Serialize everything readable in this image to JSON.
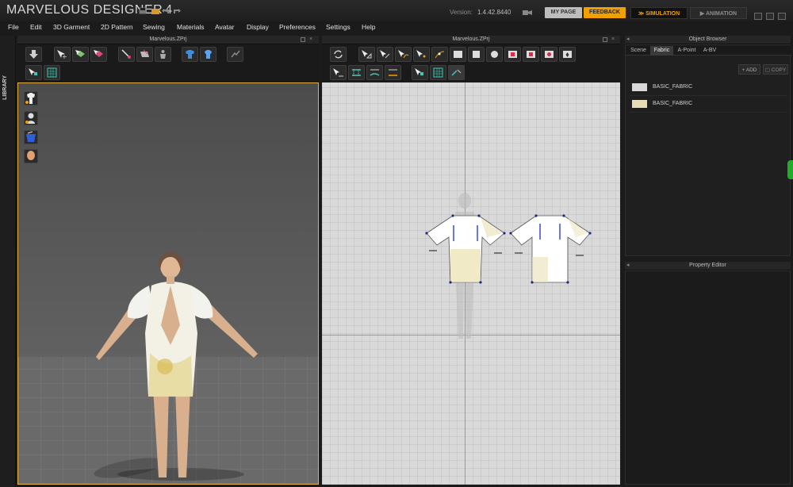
{
  "app": {
    "title": "MARVELOUS DESIGNER",
    "version_number": "4"
  },
  "header": {
    "version_label": "Version:",
    "version_value": "1.4.42.8440",
    "my_page_label": "MY PAGE",
    "feedback_label": "FEEDBACK",
    "simulation_label": "SIMULATION",
    "animation_label": "ANIMATION"
  },
  "menu": {
    "items": [
      "File",
      "Edit",
      "3D Garment",
      "2D Pattern",
      "Sewing",
      "Materials",
      "Avatar",
      "Display",
      "Preferences",
      "Settings",
      "Help"
    ]
  },
  "library": {
    "label": "LIBRARY"
  },
  "panel3d": {
    "title": "Marvelous.ZPrj"
  },
  "panel2d": {
    "title": "Marvelous.ZPrj"
  },
  "object_browser": {
    "title": "Object Browser",
    "tabs": [
      "Scene",
      "Fabric",
      "A-Point",
      "A-BV"
    ],
    "active_tab": "Fabric",
    "add_label": "ADD",
    "copy_label": "COPY",
    "fabrics": [
      {
        "name": "BASIC_FABRIC",
        "swatch": "#d8d8d8"
      },
      {
        "name": "BASIC_FABRIC",
        "swatch": "#e8dcb4"
      }
    ]
  },
  "property_editor": {
    "title": "Property Editor"
  },
  "colors": {
    "accent": "#f0a000",
    "viewport_border": "#e2b046",
    "status_green": "#1fae2b"
  }
}
